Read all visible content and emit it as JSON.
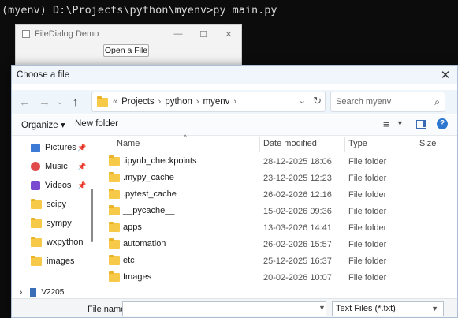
{
  "console": {
    "prompt": "(myenv) D:\\Projects\\python\\myenv>py main.py"
  },
  "demo_window": {
    "title": "FileDialog Demo",
    "minimize": "—",
    "maximize": "☐",
    "close": "✕",
    "open_button": "Open a File"
  },
  "dialog": {
    "title": "Choose a file",
    "close": "✕",
    "address": {
      "overflow": "«",
      "crumbs": [
        "Projects",
        "python",
        "myenv"
      ]
    },
    "search_placeholder": "Search myenv",
    "toolbar": {
      "organize": "Organize ▾",
      "new_folder": "New folder"
    },
    "nav": [
      {
        "label": "Pictures",
        "icon": "pictures-icon",
        "pinned": true
      },
      {
        "label": "Music",
        "icon": "music-icon",
        "pinned": true
      },
      {
        "label": "Videos",
        "icon": "videos-icon",
        "pinned": true
      },
      {
        "label": "scipy",
        "icon": "folder-icon",
        "pinned": false
      },
      {
        "label": "sympy",
        "icon": "folder-icon",
        "pinned": false
      },
      {
        "label": "wxpython",
        "icon": "folder-icon",
        "pinned": false
      },
      {
        "label": "images",
        "icon": "folder-icon",
        "pinned": false
      }
    ],
    "nav_drive": "V2205",
    "columns": {
      "name": "Name",
      "date": "Date modified",
      "type": "Type",
      "size": "Size"
    },
    "files": [
      {
        "name": ".ipynb_checkpoints",
        "date": "28-12-2025 18:06",
        "type": "File folder"
      },
      {
        "name": ".mypy_cache",
        "date": "23-12-2025 12:23",
        "type": "File folder"
      },
      {
        "name": ".pytest_cache",
        "date": "26-02-2026 12:16",
        "type": "File folder"
      },
      {
        "name": "__pycache__",
        "date": "15-02-2026 09:36",
        "type": "File folder"
      },
      {
        "name": "apps",
        "date": "13-03-2026 14:41",
        "type": "File folder"
      },
      {
        "name": "automation",
        "date": "26-02-2026 15:57",
        "type": "File folder"
      },
      {
        "name": "etc",
        "date": "25-12-2025 16:37",
        "type": "File folder"
      },
      {
        "name": "Images",
        "date": "20-02-2026 10:07",
        "type": "File folder"
      }
    ],
    "filename_label": "File name:",
    "filename_value": "",
    "filetype_selected": "Text Files (*.txt)"
  }
}
